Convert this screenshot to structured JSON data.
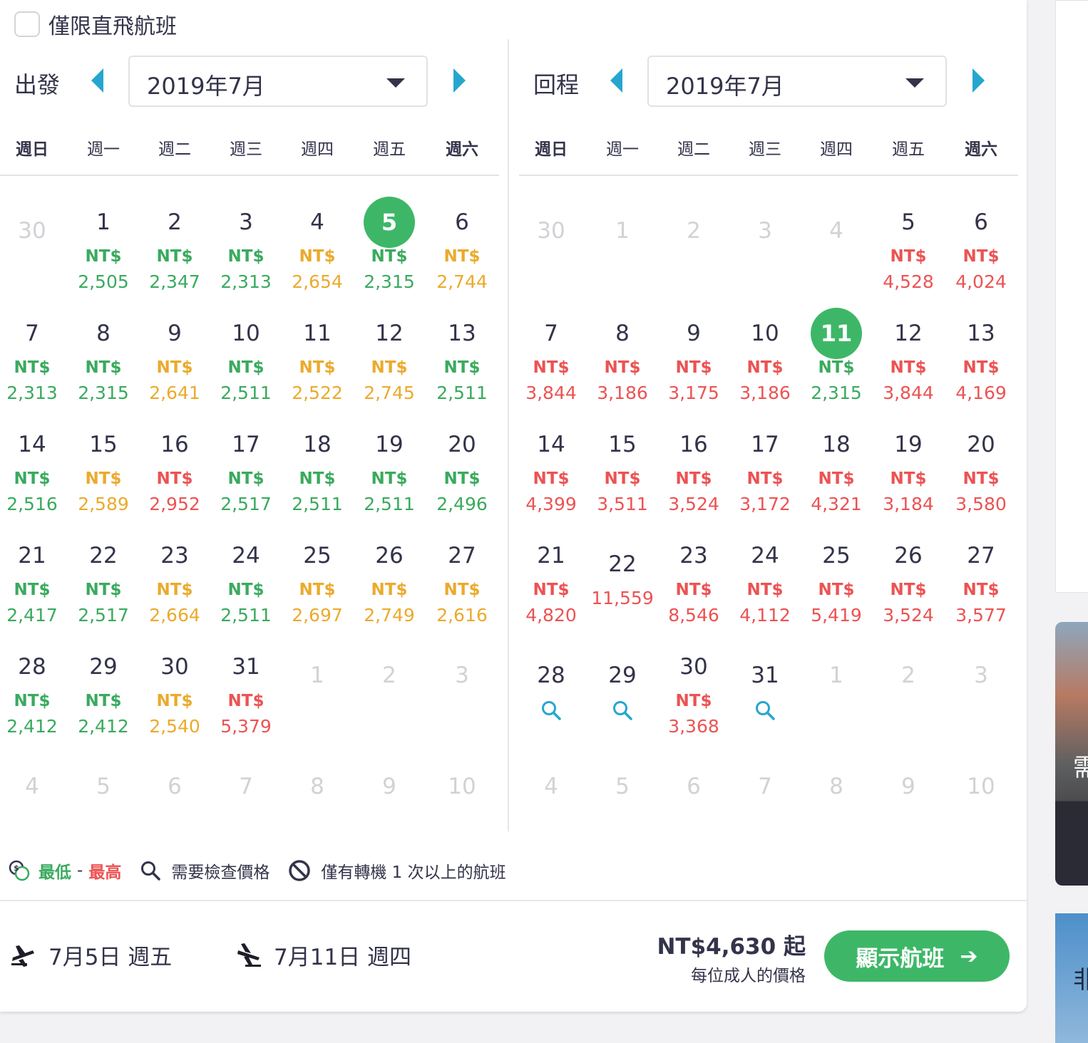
{
  "filter": {
    "direct_label": "僅限直飛航班"
  },
  "weekdays": [
    "週日",
    "週一",
    "週二",
    "週三",
    "週四",
    "週五",
    "週六"
  ],
  "depart": {
    "label": "出發",
    "month": "2019年7月",
    "weeks": [
      [
        {
          "d": "30",
          "m": true
        },
        {
          "d": "1",
          "p": "2,505",
          "c": "green"
        },
        {
          "d": "2",
          "p": "2,347",
          "c": "green"
        },
        {
          "d": "3",
          "p": "2,313",
          "c": "green"
        },
        {
          "d": "4",
          "p": "2,654",
          "c": "orange"
        },
        {
          "d": "5",
          "p": "2,315",
          "c": "green",
          "sel": true
        },
        {
          "d": "6",
          "p": "2,744",
          "c": "orange"
        }
      ],
      [
        {
          "d": "7",
          "p": "2,313",
          "c": "green"
        },
        {
          "d": "8",
          "p": "2,315",
          "c": "green"
        },
        {
          "d": "9",
          "p": "2,641",
          "c": "orange"
        },
        {
          "d": "10",
          "p": "2,511",
          "c": "green"
        },
        {
          "d": "11",
          "p": "2,522",
          "c": "orange"
        },
        {
          "d": "12",
          "p": "2,745",
          "c": "orange"
        },
        {
          "d": "13",
          "p": "2,511",
          "c": "green"
        }
      ],
      [
        {
          "d": "14",
          "p": "2,516",
          "c": "green"
        },
        {
          "d": "15",
          "p": "2,589",
          "c": "orange"
        },
        {
          "d": "16",
          "p": "2,952",
          "c": "red"
        },
        {
          "d": "17",
          "p": "2,517",
          "c": "green"
        },
        {
          "d": "18",
          "p": "2,511",
          "c": "green"
        },
        {
          "d": "19",
          "p": "2,511",
          "c": "green"
        },
        {
          "d": "20",
          "p": "2,496",
          "c": "green"
        }
      ],
      [
        {
          "d": "21",
          "p": "2,417",
          "c": "green"
        },
        {
          "d": "22",
          "p": "2,517",
          "c": "green"
        },
        {
          "d": "23",
          "p": "2,664",
          "c": "orange"
        },
        {
          "d": "24",
          "p": "2,511",
          "c": "green"
        },
        {
          "d": "25",
          "p": "2,697",
          "c": "orange"
        },
        {
          "d": "26",
          "p": "2,749",
          "c": "orange"
        },
        {
          "d": "27",
          "p": "2,616",
          "c": "orange"
        }
      ],
      [
        {
          "d": "28",
          "p": "2,412",
          "c": "green"
        },
        {
          "d": "29",
          "p": "2,412",
          "c": "green"
        },
        {
          "d": "30",
          "p": "2,540",
          "c": "orange"
        },
        {
          "d": "31",
          "p": "5,379",
          "c": "red"
        },
        {
          "d": "1",
          "m": true
        },
        {
          "d": "2",
          "m": true
        },
        {
          "d": "3",
          "m": true
        }
      ],
      [
        {
          "d": "4",
          "m": true
        },
        {
          "d": "5",
          "m": true
        },
        {
          "d": "6",
          "m": true
        },
        {
          "d": "7",
          "m": true
        },
        {
          "d": "8",
          "m": true
        },
        {
          "d": "9",
          "m": true
        },
        {
          "d": "10",
          "m": true
        }
      ]
    ]
  },
  "return": {
    "label": "回程",
    "month": "2019年7月",
    "weeks": [
      [
        {
          "d": "30",
          "m": true
        },
        {
          "d": "1",
          "m": true
        },
        {
          "d": "2",
          "m": true
        },
        {
          "d": "3",
          "m": true
        },
        {
          "d": "4",
          "m": true
        },
        {
          "d": "5",
          "p": "4,528",
          "c": "red"
        },
        {
          "d": "6",
          "p": "4,024",
          "c": "red"
        }
      ],
      [
        {
          "d": "7",
          "p": "3,844",
          "c": "red"
        },
        {
          "d": "8",
          "p": "3,186",
          "c": "red"
        },
        {
          "d": "9",
          "p": "3,175",
          "c": "red"
        },
        {
          "d": "10",
          "p": "3,186",
          "c": "red"
        },
        {
          "d": "11",
          "p": "2,315",
          "c": "green",
          "sel": true
        },
        {
          "d": "12",
          "p": "3,844",
          "c": "red"
        },
        {
          "d": "13",
          "p": "4,169",
          "c": "red"
        }
      ],
      [
        {
          "d": "14",
          "p": "4,399",
          "c": "red"
        },
        {
          "d": "15",
          "p": "3,511",
          "c": "red"
        },
        {
          "d": "16",
          "p": "3,524",
          "c": "red"
        },
        {
          "d": "17",
          "p": "3,172",
          "c": "red"
        },
        {
          "d": "18",
          "p": "4,321",
          "c": "red"
        },
        {
          "d": "19",
          "p": "3,184",
          "c": "red"
        },
        {
          "d": "20",
          "p": "3,580",
          "c": "red"
        }
      ],
      [
        {
          "d": "21",
          "p": "4,820",
          "c": "red"
        },
        {
          "d": "22",
          "p": "11,559",
          "c": "red",
          "nolabel": true
        },
        {
          "d": "23",
          "p": "8,546",
          "c": "red"
        },
        {
          "d": "24",
          "p": "4,112",
          "c": "red"
        },
        {
          "d": "25",
          "p": "5,419",
          "c": "red"
        },
        {
          "d": "26",
          "p": "3,524",
          "c": "red"
        },
        {
          "d": "27",
          "p": "3,577",
          "c": "red"
        }
      ],
      [
        {
          "d": "28",
          "s": true
        },
        {
          "d": "29",
          "s": true
        },
        {
          "d": "30",
          "p": "3,368",
          "c": "red"
        },
        {
          "d": "31",
          "s": true
        },
        {
          "d": "1",
          "m": true
        },
        {
          "d": "2",
          "m": true
        },
        {
          "d": "3",
          "m": true
        }
      ],
      [
        {
          "d": "4",
          "m": true
        },
        {
          "d": "5",
          "m": true
        },
        {
          "d": "6",
          "m": true
        },
        {
          "d": "7",
          "m": true
        },
        {
          "d": "8",
          "m": true
        },
        {
          "d": "9",
          "m": true
        },
        {
          "d": "10",
          "m": true
        }
      ]
    ]
  },
  "currency_label": "NT$",
  "legend": {
    "lowest": "最低",
    "dash": "-",
    "highest": "最高",
    "check_price": "需要檢查價格",
    "one_stop": "僅有轉機 1 次以上的航班"
  },
  "footer": {
    "depart_date": "7月5日 週五",
    "return_date": "7月11日 週四",
    "price": "NT$4,630 起",
    "price_note": "每位成人的價格",
    "button": "顯示航班",
    "button_arrow": "➔"
  },
  "side": {
    "text_1": "需",
    "text_2": "非"
  },
  "colors": {
    "green": "#3aaa5e",
    "orange": "#ebaa2c",
    "red": "#ec5353",
    "accent": "#26a6cf",
    "button": "#3db767"
  }
}
